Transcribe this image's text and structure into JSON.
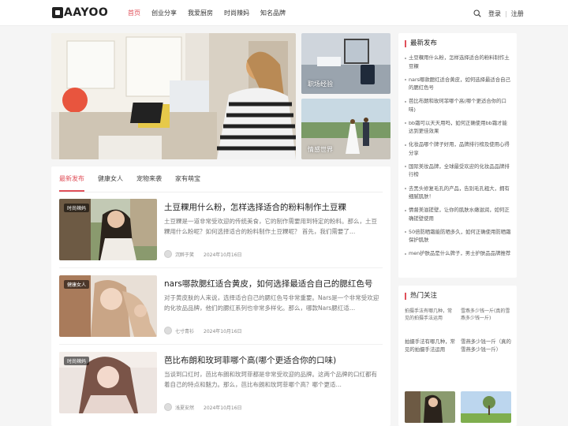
{
  "header": {
    "logo_text": "AAYOO",
    "nav": [
      "首页",
      "创业分享",
      "我爱厨房",
      "时尚辣妈",
      "知名品牌"
    ],
    "login": "登录",
    "separator": "|",
    "register": "注册"
  },
  "banner": {
    "side_top_caption": "职场经验",
    "side_bottom_caption": "情感世界"
  },
  "tabs": [
    "最新发布",
    "健康女人",
    "宠物来袭",
    "家有萌宝"
  ],
  "articles": [
    {
      "tag": "时尚辣妈",
      "title": "土豆粿用什么粉，怎样选择适合的粉料制作土豆粿",
      "desc": "土豆粿是一道非常受欢迎的传统美食，它的制作需要用到特定的粉料。那么，土豆粿用什么粉呢？如何选择适合的粉料制作土豆粿呢？ 首先，我们需要了…",
      "author": "沉醉于笑",
      "date": "2024年10月16日"
    },
    {
      "tag": "健康女人",
      "title": "nars哪款腮红适合黄皮，如何选择最适合自己的腮红色号",
      "desc": "对于黄皮肤的人来说，选择适合自己的腮红色号非常重要。Nars是一个非常受欢迎的化妆品品牌，他们的腮红系列也非常多样化。那么，哪款Nars腮红适…",
      "author": "七寸青衫",
      "date": "2024年10月16日"
    },
    {
      "tag": "时尚辣妈",
      "title": "芭比布朗和玫珂菲哪个高(哪个更适合你的口味)",
      "desc": "当谈到口红时，芭比布朗和玫珂菲都是非常受欢迎的品牌。这两个品牌的口红都有着自己的特点和魅力。那么，芭比布朗和玫珂菲哪个高？哪个更适…",
      "author": "浅夏安然",
      "date": "2024年10月16日"
    }
  ],
  "sidebar": {
    "latest_title": "最新发布",
    "latest": [
      "土豆粿用什么粉，怎样选择适合的粉料制作土豆粿",
      "nars哪款腮红适合黄皮，如何选择最适合自己的腮红色号",
      "芭比布朗和玫珂菲哪个高(哪个更适合你的口味)",
      "bb霜可以天天用吗，如何正确使用bb霜才能达到更佳效果",
      "化妆品哪个牌子好用，品牌排行榜及使用心得分享",
      "国际美妆品牌，全球最受欢迎的化妆品品牌排行榜",
      "去黑头修复毛孔的产品，告别毛孔粗大，拥有细腻肌肤！",
      "情督美滋搓壁，让你的肌肤水嫩滋润，如何正确搓壁使用",
      "50倍防晒霜能防晒多久，如何正确使用防晒霜保护肌肤",
      "men护肤品是什么牌子，男士护肤品品牌推荐"
    ],
    "hot_title": "热门关注",
    "hot": [
      {
        "alt": "拍摄手法有哪几种，常见的拍摄手法运用",
        "caption": "拍摄手法有哪几种，常见的拍摄手法运用"
      },
      {
        "alt": "雪燕多少钱一斤(真的雪燕多少钱一斤)",
        "caption": "雪燕多少钱一斤（真的雪燕多少钱一斤）"
      }
    ]
  },
  "colors": {
    "accent": "#e0505a"
  }
}
